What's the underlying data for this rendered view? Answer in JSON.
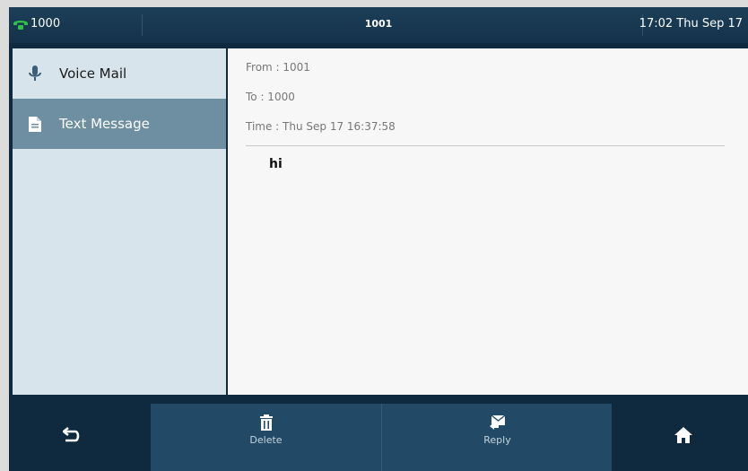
{
  "status": {
    "account": "1000",
    "title": "1001",
    "clock": "17:02 Thu Sep 17"
  },
  "sidebar": {
    "items": [
      {
        "label": "Voice Mail",
        "icon": "microphone-icon"
      },
      {
        "label": "Text Message",
        "icon": "document-icon"
      }
    ]
  },
  "message": {
    "from": "From : 1001",
    "to": "To : 1000",
    "time": "Time : Thu Sep 17 16:37:58",
    "body": "hi"
  },
  "softkeys": {
    "delete": "Delete",
    "reply": "Reply"
  },
  "colors": {
    "status_bar": "#14324a",
    "sidebar": "#d7e4ec",
    "sidebar_active": "#6e8ea2",
    "softkey_bg": "#224a66",
    "phone_icon": "#2fbf4a"
  }
}
